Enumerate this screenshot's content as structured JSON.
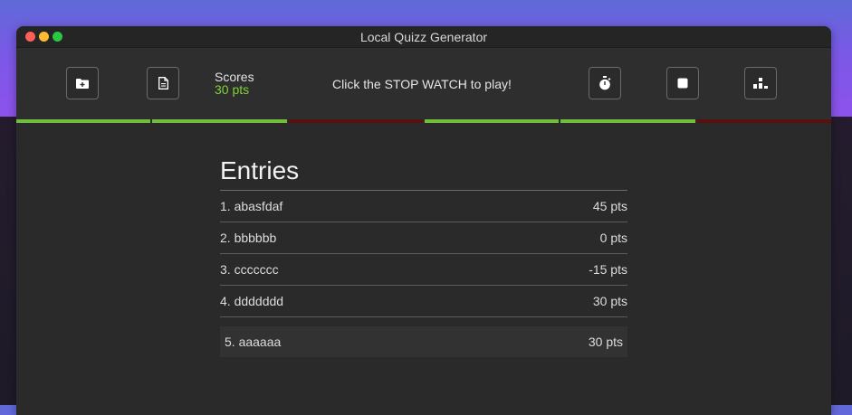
{
  "window": {
    "title": "Local Quizz Generator"
  },
  "toolbar": {
    "buttons": [
      {
        "icon": "folder-plus-icon"
      },
      {
        "icon": "document-icon"
      },
      {
        "icon": "stopwatch-icon"
      },
      {
        "icon": "stop-icon"
      },
      {
        "icon": "podium-icon"
      }
    ],
    "scores_label": "Scores",
    "scores_value": "30 pts",
    "hint": "Click the STOP WATCH to play!"
  },
  "progress": {
    "segments": [
      "correct",
      "correct",
      "wrong",
      "correct",
      "correct",
      "wrong"
    ],
    "colors": {
      "correct": "#6fbf3b",
      "wrong": "#5b1010"
    }
  },
  "entries": {
    "title": "Entries",
    "rows": [
      {
        "name": "1. abasfdaf",
        "score": "45 pts"
      },
      {
        "name": "2. bbbbbb",
        "score": "0 pts"
      },
      {
        "name": "3. ccccccc",
        "score": "-15 pts"
      },
      {
        "name": "4. ddddddd",
        "score": "30 pts"
      },
      {
        "name": "5. aaaaaa",
        "score": "30 pts"
      }
    ]
  },
  "colors": {
    "accent_green": "#7fd33a",
    "window_bg": "#2a2a2a"
  }
}
